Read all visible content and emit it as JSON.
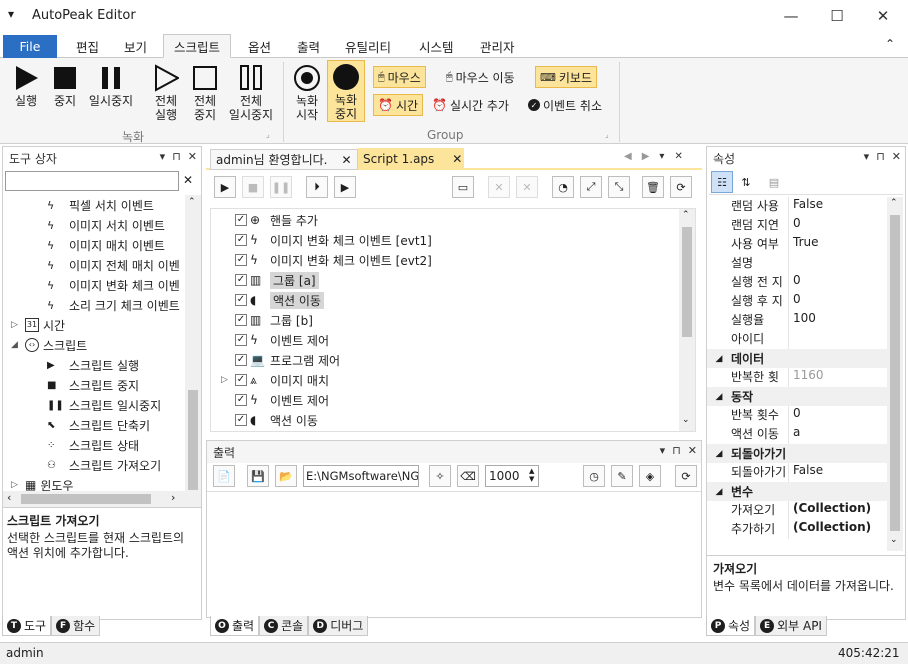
{
  "window": {
    "title": "AutoPeak Editor",
    "menu_glyph": "▾",
    "minimize": "—",
    "maximize": "☐",
    "close": "✕"
  },
  "ribbon_tabs": [
    "File",
    "편집",
    "보기",
    "스크립트",
    "옵션",
    "출력",
    "유틸리티",
    "시스템",
    "관리자"
  ],
  "ribbon_collapse": "⌃",
  "ribbon": {
    "record_group": {
      "label": "녹화",
      "buttons": [
        "실행",
        "중지",
        "일시중지",
        "전체\n실행",
        "전체\n중지",
        "전체\n일시중지"
      ]
    },
    "group2": {
      "label": "Group",
      "big": [
        "녹화\n시작",
        "녹화\n중지"
      ],
      "small": [
        "마우스",
        "마우스 이동",
        "키보드",
        "시간",
        "실시간 추가",
        "이벤트 취소"
      ]
    }
  },
  "toolbox": {
    "title": "도구 상자",
    "search_placeholder": "",
    "clear": "✕",
    "items": [
      "픽셀 서치 이벤트",
      "이미지 서치 이벤트",
      "이미지 매치 이벤트",
      "이미지 전체 매치 이벤",
      "이미지 변화 체크 이벤",
      "소리 크기 체크 이벤트"
    ],
    "groups": [
      {
        "label": "시간",
        "icon_text": "31"
      },
      {
        "label": "스크립트"
      }
    ],
    "script_items": [
      "스크립트 실행",
      "스크립트 중지",
      "스크립트 일시중지",
      "스크립트 단축키",
      "스크립트 상태",
      "스크립트 가져오기"
    ],
    "windows_group": "윈도우",
    "desc_title": "스크립트 가져오기",
    "desc_text": "선택한 스크립트를 현재 스크립트의 액션 위치에 추가합니다.",
    "tabs": [
      {
        "letter": "T",
        "label": "도구"
      },
      {
        "letter": "F",
        "label": "함수"
      }
    ]
  },
  "doc_tabs": [
    {
      "label": "admin님 환영합니다.",
      "close": "✕"
    },
    {
      "label": "Script 1.aps",
      "close": "✕"
    }
  ],
  "doc_nav": [
    "◀",
    "▶",
    "▾",
    "✕"
  ],
  "script_lines": [
    {
      "label": "핸들 추가",
      "icon": "crosshair"
    },
    {
      "label": "이미지 변화 체크 이벤트 [evt1]",
      "icon": "bolt"
    },
    {
      "label": "이미지 변화 체크 이벤트 [evt2]",
      "icon": "bolt"
    },
    {
      "label": "그룹 [a]",
      "icon": "group"
    },
    {
      "label": "액션 이동",
      "icon": "action"
    },
    {
      "label": "그룹 [b]",
      "icon": "group"
    },
    {
      "label": "이벤트 제어",
      "icon": "bolt"
    },
    {
      "label": "프로그램 제어",
      "icon": "laptop"
    },
    {
      "label": "이미지 매치",
      "icon": "match"
    },
    {
      "label": "이벤트 제어",
      "icon": "bolt"
    },
    {
      "label": "액션 이동",
      "icon": "action"
    }
  ],
  "output": {
    "title": "출력",
    "path": "E:\\NGMsoftware\\NG",
    "number": "1000",
    "nav": [
      "▾",
      "⊓",
      "✕"
    ],
    "tabs": [
      {
        "letter": "O",
        "label": "출력"
      },
      {
        "letter": "C",
        "label": "콘솔"
      },
      {
        "letter": "D",
        "label": "디버그"
      }
    ]
  },
  "properties": {
    "title": "속성",
    "rows": [
      {
        "type": "row",
        "k": "랜덤 사용",
        "v": "False"
      },
      {
        "type": "row",
        "k": "랜덤 지연",
        "v": "0"
      },
      {
        "type": "row",
        "k": "사용 여부",
        "v": "True"
      },
      {
        "type": "row",
        "k": "설명",
        "v": ""
      },
      {
        "type": "row",
        "k": "실행 전 지",
        "v": "0"
      },
      {
        "type": "row",
        "k": "실행 후 지",
        "v": "0"
      },
      {
        "type": "row",
        "k": "실행율",
        "v": "100"
      },
      {
        "type": "row",
        "k": "아이디",
        "v": ""
      },
      {
        "type": "cat",
        "k": "데이터"
      },
      {
        "type": "row",
        "k": "반복한 횟",
        "v": "1160",
        "gray": true
      },
      {
        "type": "cat",
        "k": "동작"
      },
      {
        "type": "row",
        "k": "반복 횟수",
        "v": "0"
      },
      {
        "type": "row",
        "k": "액션 이동",
        "v": "a"
      },
      {
        "type": "cat",
        "k": "되돌아가기"
      },
      {
        "type": "row",
        "k": "되돌아가기",
        "v": "False"
      },
      {
        "type": "cat",
        "k": "변수"
      },
      {
        "type": "row",
        "k": "가져오기",
        "v": "(Collection)",
        "bold": true
      },
      {
        "type": "row",
        "k": "추가하기",
        "v": "(Collection)",
        "bold": true
      }
    ],
    "desc_title": "가져오기",
    "desc_text": "변수 목록에서 데이터를 가져옵니다.",
    "tabs": [
      {
        "letter": "P",
        "label": "속성"
      },
      {
        "letter": "E",
        "label": "외부 API"
      }
    ]
  },
  "status": {
    "user": "admin",
    "time": "405:42:21"
  },
  "colors": {
    "accent": "#2b6fc4",
    "highlight": "#fce49b"
  }
}
